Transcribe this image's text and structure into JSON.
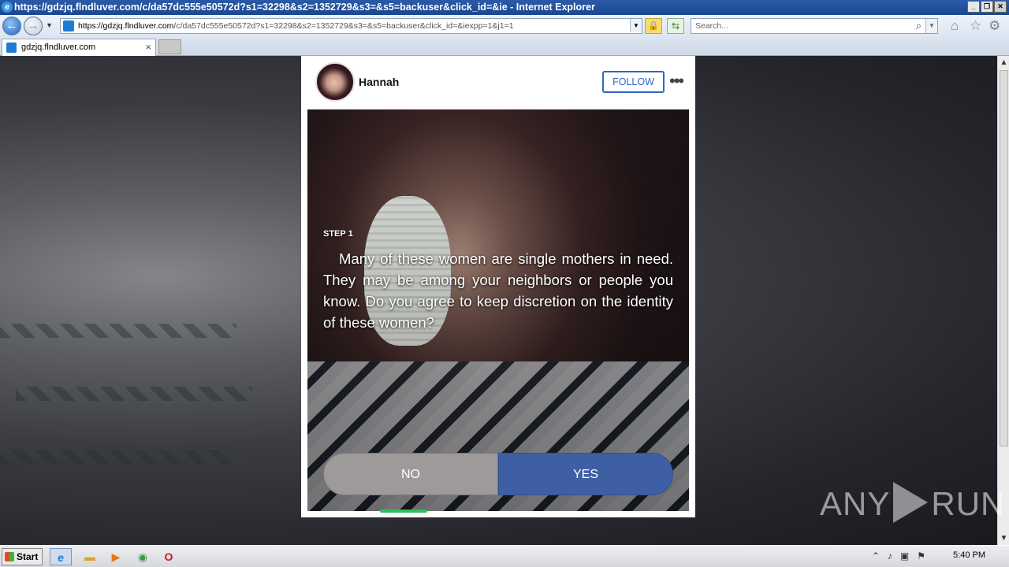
{
  "window": {
    "title": "https://gdzjq.flndluver.com/c/da57dc555e50572d?s1=32298&s2=1352729&s3=&s5=backuser&click_id=&ie - Internet Explorer",
    "controls": [
      "minimize",
      "restore",
      "close"
    ]
  },
  "browser": {
    "address_prefix": "https://gdzjq.",
    "address_host": "flndluver.com",
    "address_path": "/c/da57dc555e50572d?s1=32298&s2=1352729&s3=&s5=backuser&click_id=&iexpp=1&j1=1",
    "search_placeholder": "Search...",
    "icons": [
      "back-icon",
      "forward-icon",
      "lock-icon",
      "refresh-icon",
      "search-icon",
      "home-icon",
      "favorites-star-icon",
      "settings-gear-icon"
    ]
  },
  "tab": {
    "label": "gdzjq.flndluver.com",
    "close": "×"
  },
  "card": {
    "username": "Hannah",
    "follow_label": "FOLLOW",
    "more_label": "•••",
    "step_label": "STEP 1",
    "message": "Many of these women are single mothers in need. They may be among your neighbors or people you know. Do you agree to keep discretion on the identity of these women?",
    "no_label": "NO",
    "yes_label": "YES",
    "progress_fraction": 0.2,
    "colors": {
      "follow": "#2f67c0",
      "yes": "#3f5fa4",
      "no": "#9e9a99",
      "progress": "#2fc05a"
    }
  },
  "watermark": {
    "left": "ANY",
    "right": "RUN"
  },
  "taskbar": {
    "start_label": "Start",
    "apps": [
      "internet-explorer-icon",
      "file-explorer-icon",
      "media-player-icon",
      "chrome-icon",
      "opera-icon"
    ],
    "clock": "5:40 PM"
  }
}
